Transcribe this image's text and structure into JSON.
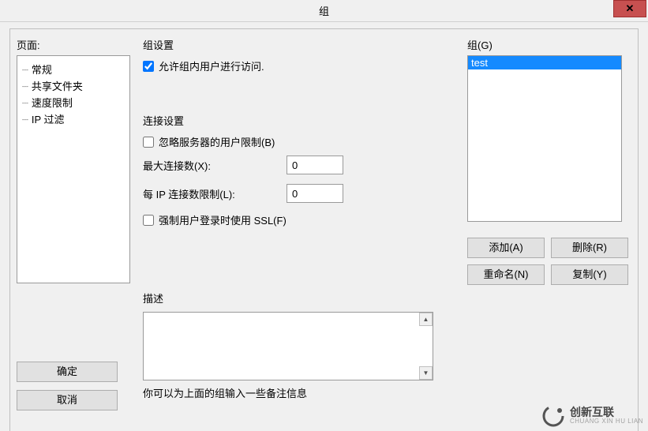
{
  "title": "组",
  "sidebar": {
    "label": "页面:",
    "items": [
      {
        "label": "常规"
      },
      {
        "label": "共享文件夹"
      },
      {
        "label": "速度限制"
      },
      {
        "label": "IP 过滤"
      }
    ]
  },
  "groupSettings": {
    "title": "组设置",
    "allowAccessLabel": "允许组内用户进行访问."
  },
  "connection": {
    "title": "连接设置",
    "ignoreServerLimitLabel": "忽略服务器的用户限制(B)",
    "maxConnLabel": "最大连接数(X):",
    "maxConnValue": "0",
    "perIpLabel": "每 IP 连接数限制(L):",
    "perIpValue": "0",
    "forceSslLabel": "强制用户登录时使用 SSL(F)"
  },
  "description": {
    "title": "描述",
    "value": "",
    "hint": "你可以为上面的组输入一些备注信息"
  },
  "groups": {
    "label": "组(G)",
    "items": [
      {
        "label": "test",
        "selected": true
      }
    ]
  },
  "buttons": {
    "ok": "确定",
    "cancel": "取消",
    "add": "添加(A)",
    "delete": "删除(R)",
    "rename": "重命名(N)",
    "copy": "复制(Y)"
  },
  "watermark": {
    "cn": "创新互联",
    "en": "CHUANG XIN HU LIAN"
  }
}
